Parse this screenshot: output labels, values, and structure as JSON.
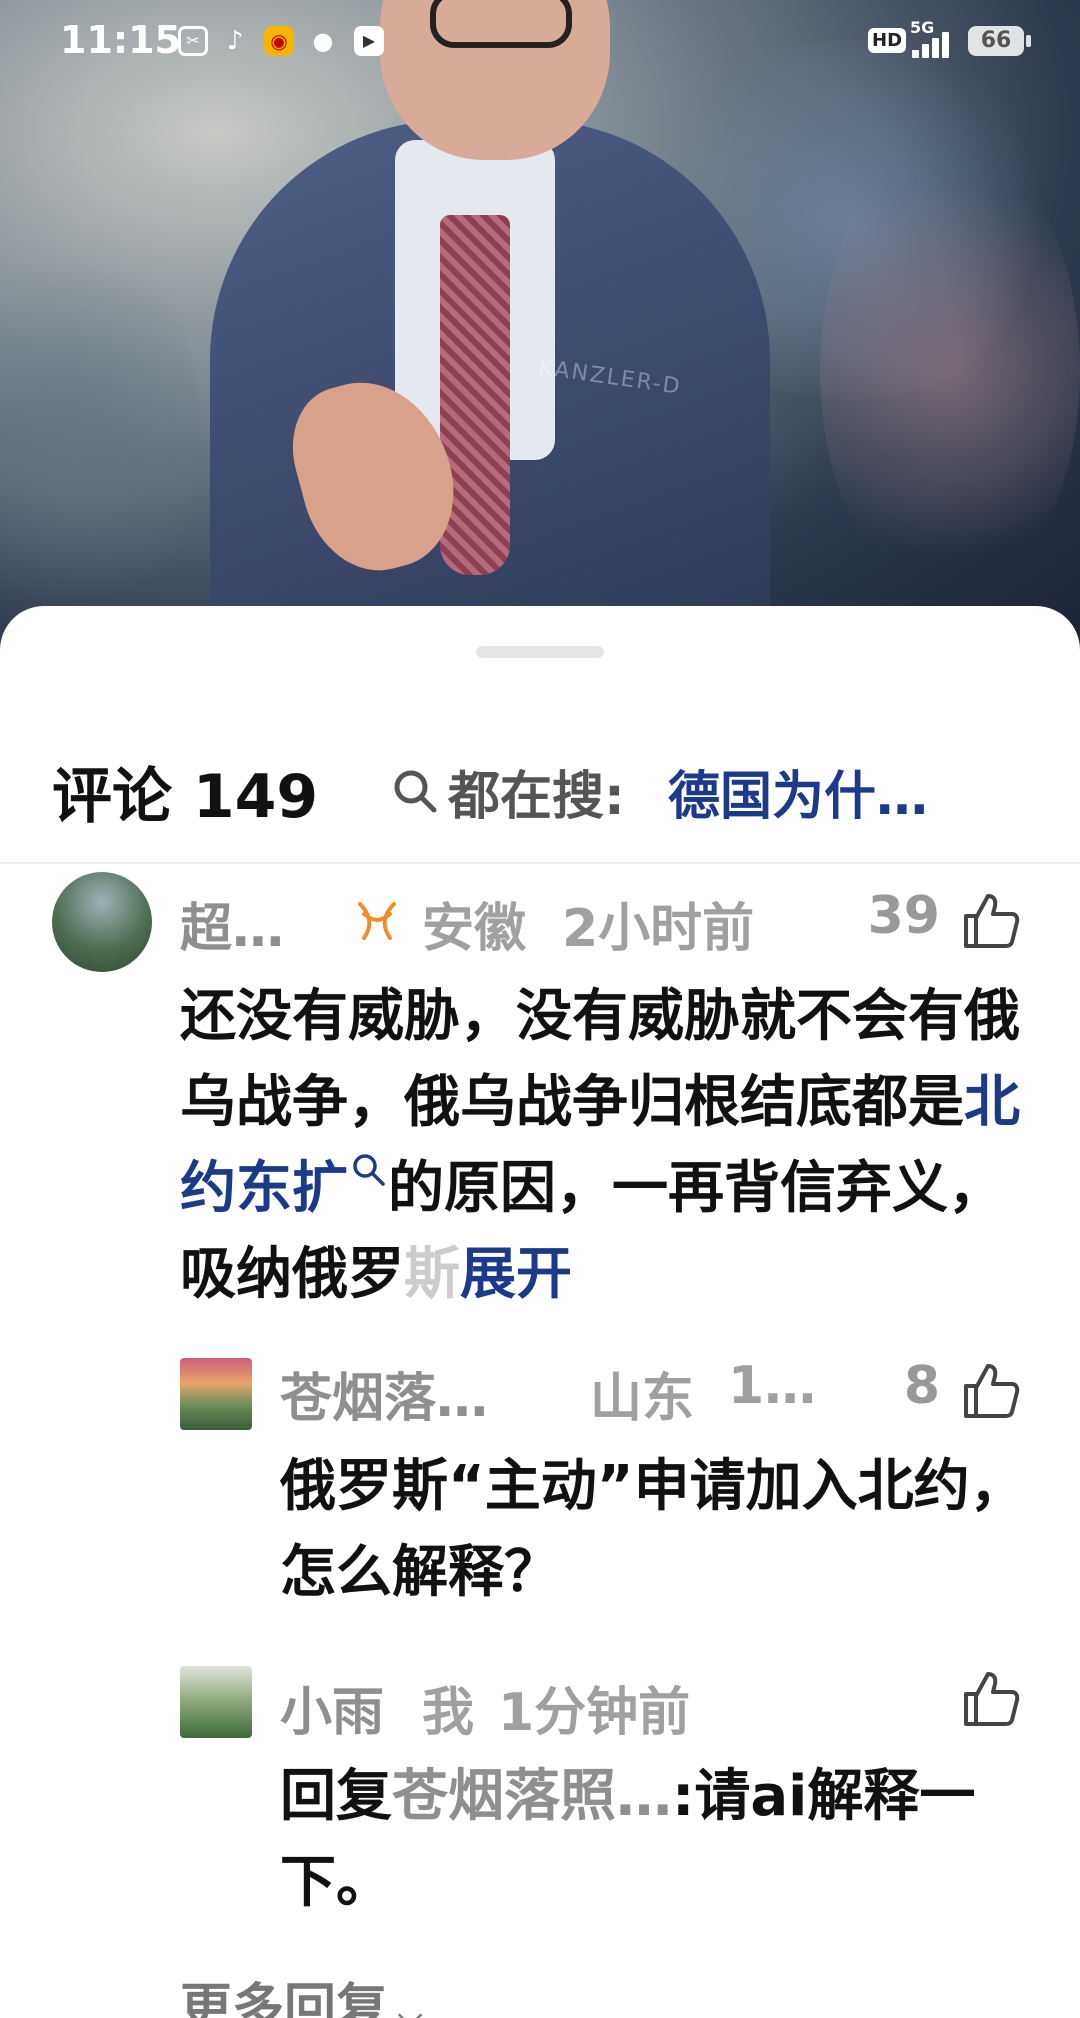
{
  "status_bar": {
    "time": "11:15",
    "network": "5G",
    "hd": "HD",
    "battery": "66",
    "app_icons": [
      "screenshot-icon",
      "tiktok-icon",
      "weibo-icon",
      "wechat-icon",
      "video-app-icon"
    ]
  },
  "photo": {
    "caption": "KANZLER-D"
  },
  "comments_panel": {
    "title": "评论 149",
    "search_label": "都在搜:",
    "search_query": "德国为什…"
  },
  "comment": {
    "author": "超…",
    "region": "安徽",
    "time": "2小时前",
    "likes": "39",
    "text_before_link": "还没有威胁，没有威胁就不会有俄乌战争，俄乌战争归根结底都是",
    "link_text": "北约东扩",
    "text_after_link": "的原因，一再背信弃义，吸纳俄罗",
    "faded_char": "斯",
    "expand_label": "展开"
  },
  "replies": [
    {
      "author": "苍烟落…",
      "region": "山东",
      "time": "1…",
      "likes": "8",
      "text": "俄罗斯“主动”申请加入北约，怎么解释？"
    },
    {
      "author": "小雨",
      "tag": "我",
      "time": "1分钟前",
      "likes": "",
      "reply_prefix": "回复",
      "reply_to": "苍烟落照…",
      "text": ":请ai解释一下。"
    }
  ],
  "more_replies_label": "更多回复"
}
